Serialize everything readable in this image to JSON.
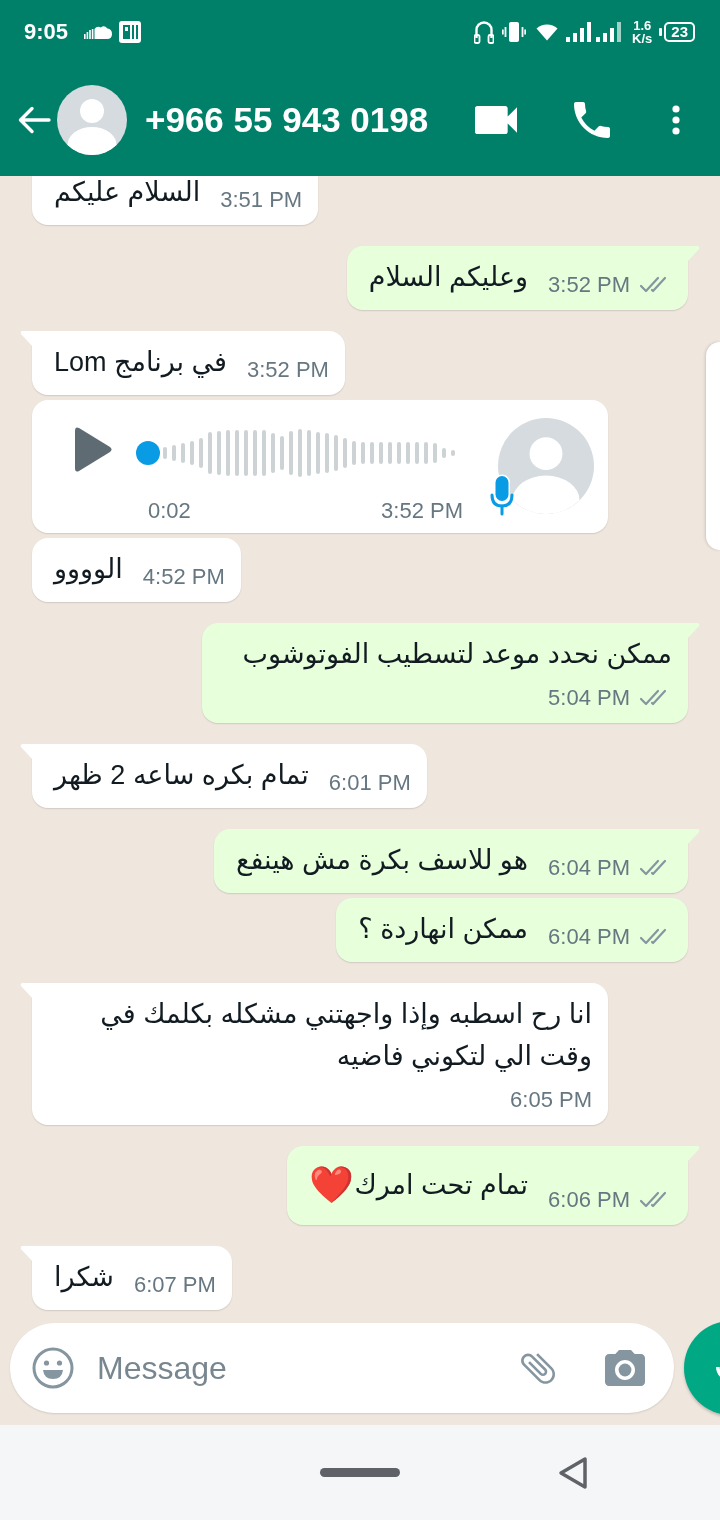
{
  "status_bar": {
    "time": "9:05",
    "network_speed": {
      "value": "1.6",
      "unit": "K/s"
    },
    "battery": "23"
  },
  "header": {
    "title": "+966 55 943 0198"
  },
  "messages": [
    {
      "outgoing": false,
      "kind": "text",
      "text": "السلام عليكم",
      "time": "3:51 PM"
    },
    {
      "outgoing": true,
      "kind": "text",
      "text": "وعليكم السلام",
      "time": "3:52 PM",
      "read": false
    },
    {
      "outgoing": false,
      "kind": "text",
      "text": "في برنامج Lom",
      "time": "3:52 PM"
    },
    {
      "outgoing": false,
      "kind": "voice",
      "duration": "0:02",
      "time": "3:52 PM",
      "level": 0
    },
    {
      "outgoing": false,
      "kind": "text",
      "text": "الوووو",
      "time": "4:52 PM"
    },
    {
      "outgoing": true,
      "kind": "text",
      "text": "ممكن نحدد موعد لتسطيب الفوتوشوب",
      "time": "5:04 PM",
      "read": false
    },
    {
      "outgoing": false,
      "kind": "text",
      "text": "تمام بكره ساعه 2 ظهر",
      "time": "6:01 PM"
    },
    {
      "outgoing": true,
      "kind": "text",
      "text": "هو للاسف بكرة مش هينفع",
      "time": "6:04 PM",
      "read": false
    },
    {
      "outgoing": true,
      "kind": "text",
      "text": "ممكن انهاردة ؟",
      "time": "6:04 PM",
      "read": false
    },
    {
      "outgoing": false,
      "kind": "text",
      "text": "انا رح اسطبه وإذا واجهتني مشكله بكلمك في وقت الي لتكوني فاضيه",
      "time": "6:05 PM"
    },
    {
      "outgoing": true,
      "kind": "text",
      "text": "تمام تحت امرك",
      "emoji": "❤️",
      "time": "6:06 PM",
      "read": false
    },
    {
      "outgoing": false,
      "kind": "text",
      "text": "شكرا",
      "time": "6:07 PM"
    }
  ],
  "composer": {
    "placeholder": "Message"
  }
}
